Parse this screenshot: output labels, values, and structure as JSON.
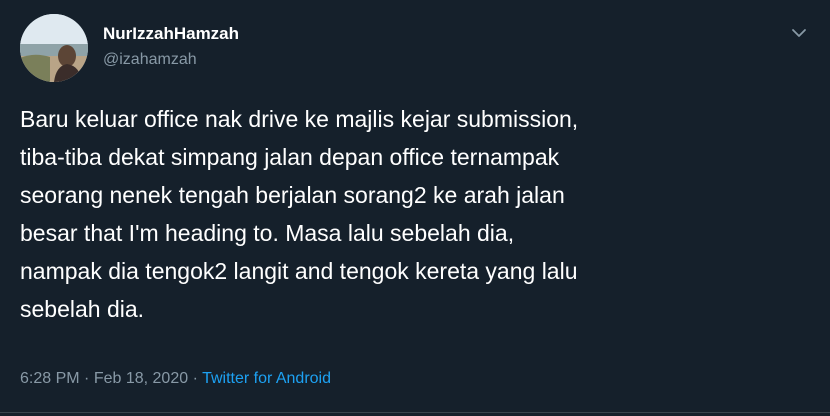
{
  "user": {
    "display_name": "NurIzzahHamzah",
    "handle": "@izahamzah"
  },
  "tweet": {
    "text": "Baru keluar office nak drive ke majlis kejar submission,\ntiba-tiba dekat simpang jalan depan office ternampak\nseorang nenek tengah berjalan sorang2 ke arah jalan\nbesar that I'm heading to. Masa lalu sebelah dia,\nnampak dia tengok2 langit and tengok kereta yang lalu\nsebelah dia.",
    "time": "6:28 PM",
    "date": "Feb 18, 2020",
    "separator": "·",
    "source": "Twitter for Android"
  },
  "icons": {
    "menu": "chevron-down-icon",
    "avatar": "profile-photo"
  },
  "colors": {
    "background": "#15202b",
    "primary_text": "#ffffff",
    "secondary_text": "#8899a6",
    "link": "#1da1f2",
    "divider": "#38444d"
  }
}
